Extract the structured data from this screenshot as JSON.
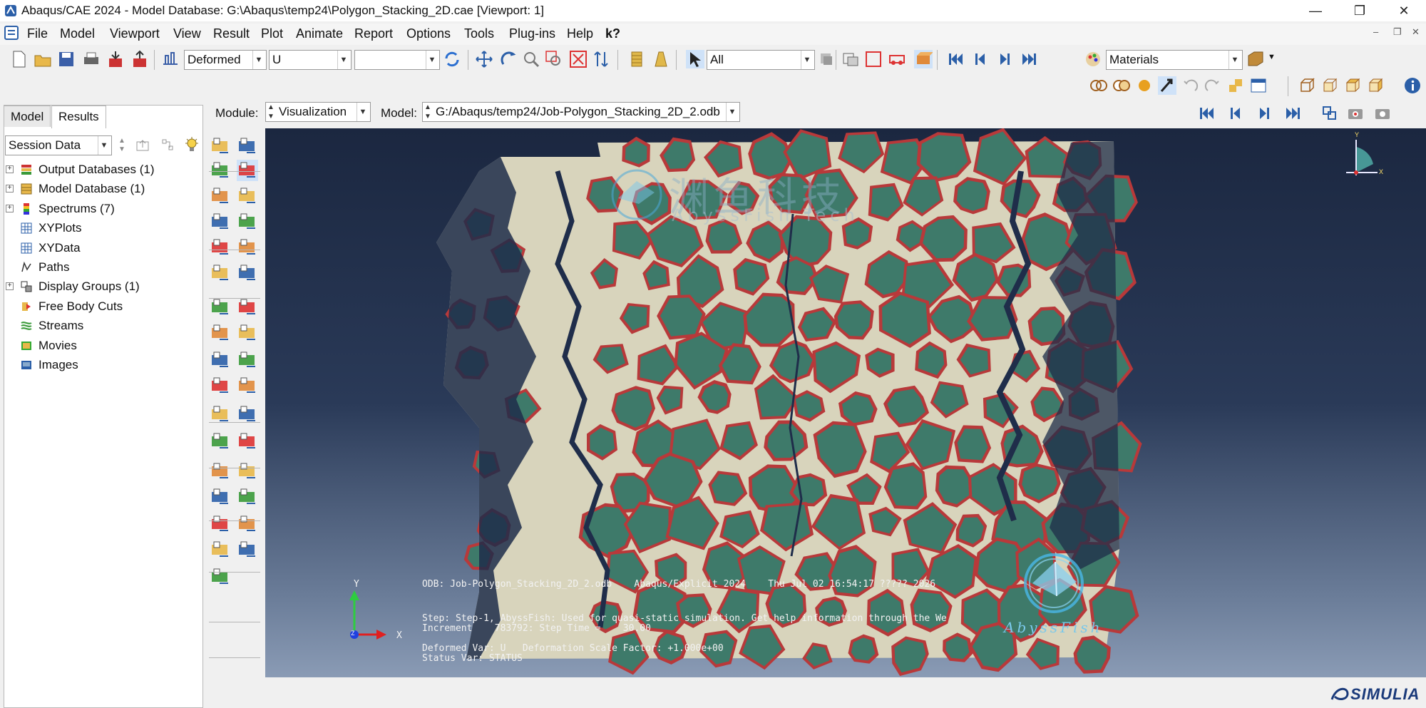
{
  "window": {
    "title": "Abaqus/CAE 2024 - Model Database: G:\\Abaqus\\temp24\\Polygon_Stacking_2D.cae [Viewport: 1]",
    "minimize": "—",
    "restore": "❐",
    "close": "✕"
  },
  "menu": {
    "items": [
      "File",
      "Model",
      "Viewport",
      "View",
      "Result",
      "Plot",
      "Animate",
      "Report",
      "Options",
      "Tools",
      "Plug-ins",
      "Help"
    ],
    "help_pointer": "k?"
  },
  "toolbar": {
    "plot_state": "Deformed",
    "field_variable": "U",
    "field_component": "",
    "selection_filter": "All",
    "color_code": "Materials"
  },
  "context": {
    "module_label": "Module:",
    "module_value": "Visualization",
    "model_label": "Model:",
    "model_value": "G:/Abaqus/temp24/Job-Polygon_Stacking_2D_2.odb"
  },
  "tree": {
    "tabs": [
      "Model",
      "Results"
    ],
    "active_tab": "Results",
    "filter": "Session Data",
    "items": [
      {
        "label": "Output Databases (1)",
        "expandable": true,
        "icon": "database-stack-icon"
      },
      {
        "label": "Model Database (1)",
        "expandable": true,
        "icon": "database-icon"
      },
      {
        "label": "Spectrums (7)",
        "expandable": true,
        "icon": "spectrum-icon"
      },
      {
        "label": "XYPlots",
        "expandable": false,
        "icon": "grid-icon"
      },
      {
        "label": "XYData",
        "expandable": false,
        "icon": "grid-icon"
      },
      {
        "label": "Paths",
        "expandable": false,
        "icon": "path-icon"
      },
      {
        "label": "Display Groups (1)",
        "expandable": true,
        "icon": "display-group-icon"
      },
      {
        "label": "Free Body Cuts",
        "expandable": false,
        "icon": "free-body-cut-icon"
      },
      {
        "label": "Streams",
        "expandable": false,
        "icon": "streams-icon"
      },
      {
        "label": "Movies",
        "expandable": false,
        "icon": "movie-icon"
      },
      {
        "label": "Images",
        "expandable": false,
        "icon": "image-icon"
      }
    ]
  },
  "viewport": {
    "odb_line": "ODB: Job-Polygon_Stacking_2D_2.odb    Abaqus/Explicit 2024    Thu Jul 02 16:54:17 ????? 2026",
    "step_line": "Step: Step-1, AbyssFish: Used for quasi-static simulation. Get help information through the We",
    "increment_line": "Increment    783792: Step Time =    30.00",
    "deformed_line": "Deformed Var: U   Deformation Scale Factor: +1.000e+00",
    "status_line": "Status Var: STATUS",
    "triad_y": "Y",
    "triad_x": "X",
    "triad_z": "Z",
    "view_triad_y": "Y",
    "view_triad_x": "X",
    "watermark_cn": "渊鱼科技",
    "watermark_en": "AbyssFish Tech",
    "watermark_logo": "AbyssFish",
    "colors": {
      "particle": "#3e7a6a",
      "rim": "#b8393a",
      "matrix": "#d8d4bc",
      "background_top": "#1b2740"
    }
  },
  "status": {
    "brand": "SIMULIA"
  }
}
